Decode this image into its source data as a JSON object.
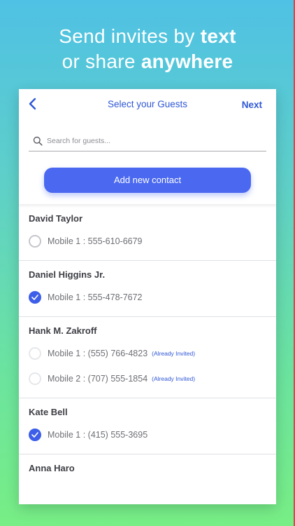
{
  "headline": {
    "line1_prefix": "Send invites by ",
    "line1_bold": "text",
    "line2_prefix": "or share ",
    "line2_bold": "anywhere"
  },
  "nav": {
    "title": "Select your Guests",
    "next_label": "Next",
    "back_icon": "chevron-left-icon"
  },
  "search": {
    "placeholder": "Search for guests...",
    "value": "",
    "icon": "search-icon"
  },
  "add_button": {
    "label": "Add new contact"
  },
  "colors": {
    "accent": "#4b69f0",
    "link": "#2f57d6",
    "text_dark": "#3d3e44",
    "text_muted": "#6e6f75"
  },
  "contacts": [
    {
      "name": "David Taylor",
      "numbers": [
        {
          "label": "Mobile 1 : 555-610-6679",
          "checked": false,
          "invited": ""
        }
      ]
    },
    {
      "name": "Daniel Higgins Jr.",
      "numbers": [
        {
          "label": "Mobile 1 : 555-478-7672",
          "checked": true,
          "invited": ""
        }
      ]
    },
    {
      "name": "Hank M. Zakroff",
      "numbers": [
        {
          "label": "Mobile 1 : (555) 766-4823",
          "checked": false,
          "invited": "(Already Invited)"
        },
        {
          "label": "Mobile 2 : (707) 555-1854",
          "checked": false,
          "invited": "(Already Invited)"
        }
      ]
    },
    {
      "name": "Kate Bell",
      "numbers": [
        {
          "label": "Mobile 1 : (415) 555-3695",
          "checked": true,
          "invited": ""
        }
      ]
    },
    {
      "name": "Anna Haro",
      "numbers": []
    }
  ]
}
